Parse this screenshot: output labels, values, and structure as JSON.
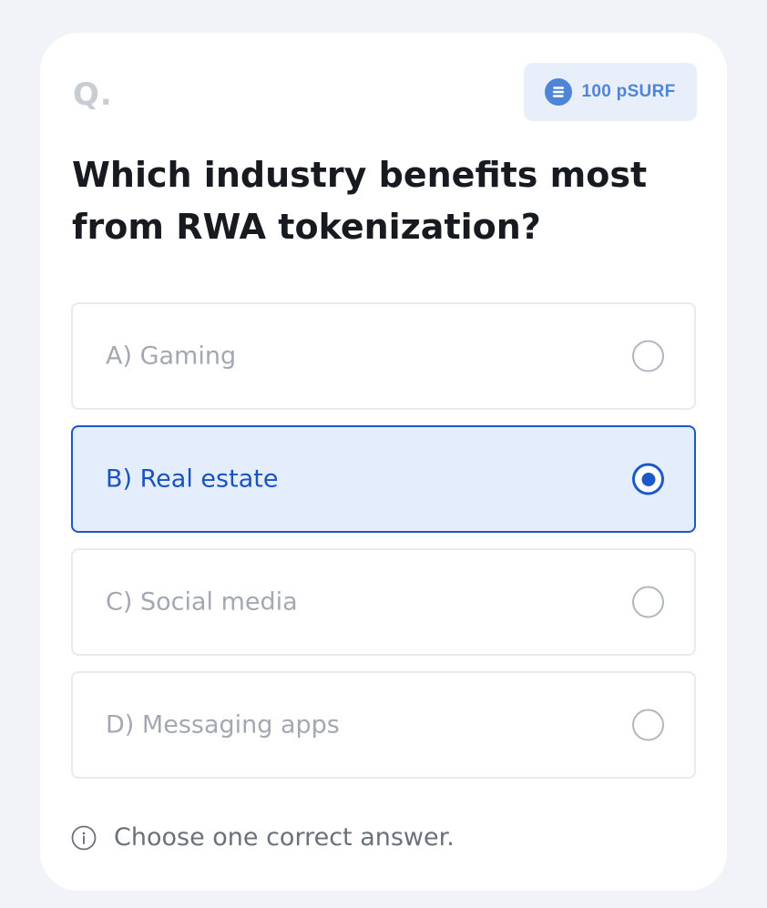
{
  "question_label": "Q.",
  "reward": {
    "label": "100 pSURF",
    "icon": "coin-icon"
  },
  "question": "Which industry benefits most from RWA tokenization?",
  "options": [
    {
      "label": "A) Gaming",
      "selected": false
    },
    {
      "label": "B) Real estate",
      "selected": true
    },
    {
      "label": "C) Social media",
      "selected": false
    },
    {
      "label": "D) Messaging apps",
      "selected": false
    }
  ],
  "hint": {
    "text": "Choose one correct answer.",
    "icon": "info-icon"
  },
  "colors": {
    "accent": "#1c58c9",
    "selected_bg": "#e4edfc",
    "badge_bg": "#e9effa",
    "badge_text": "#4f85d8",
    "page_bg": "#f1f3f8"
  }
}
